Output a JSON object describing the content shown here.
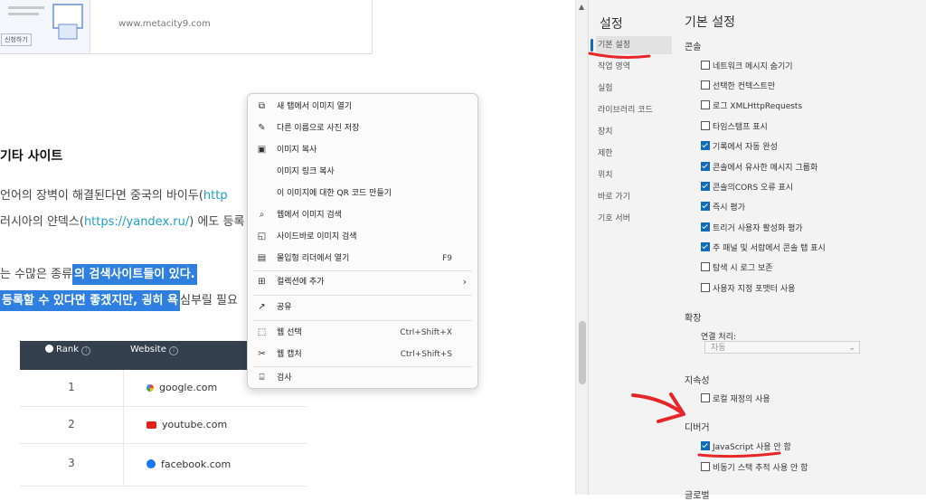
{
  "blog": {
    "card_url": "www.metacity9.com",
    "card_button": "신청하기",
    "heading": "기타 사이트",
    "line1_a": "언어의 장벽이 해결된다면 중국의 바이두(",
    "line1_link": "http",
    "line2_a": "러시아의 얀덱스(",
    "line2_link": "https://yandex.ru/",
    "line2_b": ") 에도 등록",
    "line3_a": "는 수많은 종류",
    "line3_hl": "의 검색사이트들이 있다.",
    "line4_hl": "등록할 수 있다면 좋겠지만, 굉히 욕",
    "line4_b": "심부릴 필요",
    "table": {
      "col_rank": "Rank",
      "col_website": "Website",
      "rows": [
        {
          "rank": "1",
          "site": "google.com"
        },
        {
          "rank": "2",
          "site": "youtube.com"
        },
        {
          "rank": "3",
          "site": "facebook.com"
        }
      ]
    }
  },
  "context_menu": {
    "items": [
      {
        "icon": "open-new-tab-icon",
        "label": "새 탭에서 이미지 열기",
        "shortcut": ""
      },
      {
        "icon": "save-as-icon",
        "label": "다른 이름으로 사진 저장",
        "shortcut": ""
      },
      {
        "icon": "copy-image-icon",
        "label": "이미지 복사",
        "shortcut": ""
      },
      {
        "icon": "",
        "label": "이미지 링크 복사",
        "shortcut": ""
      },
      {
        "icon": "",
        "label": "이 이미지에 대한 QR 코드 만들기",
        "shortcut": ""
      },
      {
        "icon": "web-search-icon",
        "label": "웹에서 이미지 검색",
        "shortcut": ""
      },
      {
        "icon": "sidebar-search-icon",
        "label": "사이드바로 이미지 검색",
        "shortcut": ""
      },
      {
        "icon": "immersive-reader-icon",
        "label": "몰입형 리더에서 열기",
        "shortcut": "F9"
      },
      {
        "icon": "collections-icon",
        "label": "컬렉션에 추가",
        "shortcut": ""
      },
      {
        "icon": "share-icon",
        "label": "공유",
        "shortcut": ""
      },
      {
        "icon": "web-select-icon",
        "label": "웹 선택",
        "shortcut": "Ctrl+Shift+X"
      },
      {
        "icon": "web-capture-icon",
        "label": "웹 캡처",
        "shortcut": "Ctrl+Shift+S"
      },
      {
        "icon": "inspect-icon",
        "label": "검사",
        "shortcut": ""
      }
    ]
  },
  "settings": {
    "title": "설정",
    "nav": [
      "기본 설정",
      "작업 영역",
      "실험",
      "라이브러리 코드",
      "장치",
      "제한",
      "위치",
      "바로 가기",
      "기호 서버"
    ],
    "content_title": "기본 설정",
    "console": {
      "label": "콘솔",
      "options": [
        {
          "label": "네트워크 메시지 숨기기",
          "checked": false
        },
        {
          "label": "선택한 컨텍스트만",
          "checked": false
        },
        {
          "label": "로그 XMLHttpRequests",
          "checked": false
        },
        {
          "label": "타임스탬프 표시",
          "checked": false
        },
        {
          "label": "기록에서 자동 완성",
          "checked": true
        },
        {
          "label": "콘솔에서 유사한 메시지 그룹화",
          "checked": true
        },
        {
          "label": "콘솔의CORS 오류 표시",
          "checked": true
        },
        {
          "label": "즉시 평가",
          "checked": true
        },
        {
          "label": "트리거 사용자 활성화 평가",
          "checked": true
        },
        {
          "label": "주 패널 및 서랍에서 콘솔 탭 표시",
          "checked": true
        },
        {
          "label": "탐색 시 로그 보존",
          "checked": false
        },
        {
          "label": "사용자 지정 포맷터 사용",
          "checked": false
        }
      ]
    },
    "extension": {
      "label": "확장",
      "handling_label": "연결 처리:",
      "handling_value": "자동"
    },
    "persistence": {
      "label": "지속성",
      "options": [
        {
          "label": "로컬 재정의 사용",
          "checked": false
        }
      ]
    },
    "debugger": {
      "label": "디버거",
      "options": [
        {
          "label": "JavaScript 사용 안 함",
          "checked": true
        },
        {
          "label": "비동기 스택 추적 사용 안 함",
          "checked": false
        }
      ]
    },
    "next_section": "글로벌"
  },
  "colors": {
    "accent": "#0f6cbd",
    "highlight": "#2f7fe0",
    "annotation": "#e8262a"
  }
}
